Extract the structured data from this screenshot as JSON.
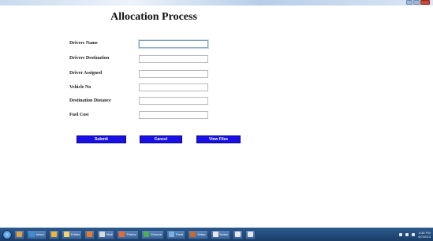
{
  "page": {
    "title": "Allocation Process"
  },
  "form": {
    "fields": [
      {
        "label": "Drivers Name",
        "value": ""
      },
      {
        "label": "Drivers Destination",
        "value": ""
      },
      {
        "label": "Driver Assigned",
        "value": ""
      },
      {
        "label": "Vehicle No",
        "value": ""
      },
      {
        "label": "Destination Distance",
        "value": ""
      },
      {
        "label": "Fuel Cost",
        "value": ""
      }
    ]
  },
  "buttons": {
    "submit": "Submit",
    "cancel": "Cancel",
    "view": "View Files"
  },
  "taskbar": {
    "items": [
      {
        "label": "",
        "icon": "#e0a23a"
      },
      {
        "label": "Inbox",
        "icon": "#3d8fd6"
      },
      {
        "label": "",
        "icon": "#f2b33a"
      },
      {
        "label": "Folder",
        "icon": "#f3d36a"
      },
      {
        "label": "",
        "icon": "#f07a1e"
      },
      {
        "label": "Mail",
        "icon": "#d9d9d9"
      },
      {
        "label": "Firefox",
        "icon": "#e86a2b"
      },
      {
        "label": "Chrome",
        "icon": "#4caf50"
      },
      {
        "label": "Paint",
        "icon": "#7ab0e0"
      },
      {
        "label": "Setup",
        "icon": "#c86a30"
      },
      {
        "label": "Notes",
        "icon": "#e6e6e6"
      },
      {
        "label": "",
        "icon": "#e6e6e6"
      },
      {
        "label": "",
        "icon": "#e6e6e6"
      }
    ],
    "clock_time": "4:45 PM",
    "clock_date": "6/7/2013"
  },
  "colors": {
    "button_bg": "#1a10e6",
    "taskbar": "#2c5b8f"
  }
}
